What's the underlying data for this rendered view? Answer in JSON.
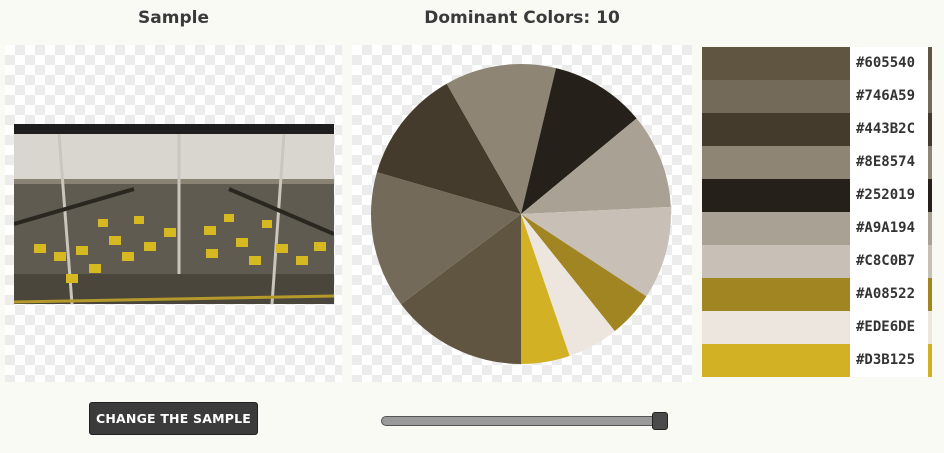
{
  "sample": {
    "heading": "Sample",
    "button_label": "CHANGE THE SAMPLE"
  },
  "colors": {
    "heading": "Dominant Colors: 10"
  },
  "slider": {
    "value_fraction": 1.0
  },
  "chart_data": {
    "type": "pie",
    "slices": [
      {
        "label": "#605540",
        "color": "#605540",
        "value": 0.1475
      },
      {
        "label": "#746A59",
        "color": "#746A59",
        "value": 0.1475
      },
      {
        "label": "#443B2C",
        "color": "#443B2C",
        "value": 0.1225
      },
      {
        "label": "#8E8574",
        "color": "#8E8574",
        "value": 0.12
      },
      {
        "label": "#252019",
        "color": "#252019",
        "value": 0.1025
      },
      {
        "label": "#A9A194",
        "color": "#A9A194",
        "value": 0.1025
      },
      {
        "label": "#C8C0B7",
        "color": "#C8C0B7",
        "value": 0.1
      },
      {
        "label": "#A08522",
        "color": "#A08522",
        "value": 0.05
      },
      {
        "label": "#EDE6DE",
        "color": "#EDE6DE",
        "value": 0.055
      },
      {
        "label": "#D3B125",
        "color": "#D3B125",
        "value": 0.0525
      }
    ]
  }
}
